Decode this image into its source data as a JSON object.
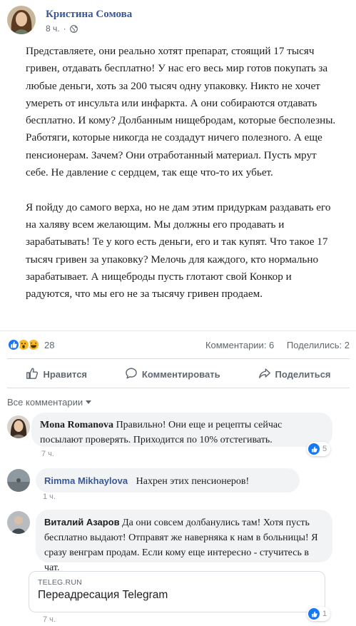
{
  "post": {
    "author": "Кристина Сомова",
    "time": "8 ч.",
    "separator": "·",
    "paragraphs": [
      "Представляете, они реально хотят препарат, стоящий 17 тысяч гривен, отдавать бесплатно! У нас его весь мир готов покупать за любые деньги, хоть за 200 тысяч одну упаковку. Никто не хочет умереть от инсульта или инфаркта. А они собираются отдавать бесплатно. И кому? Долбанным нищебродам, которые бесполезны. Работяги, которые никогда не создадут ничего полезного. А еще пенсионерам. Зачем? Они отработанный материал. Пусть мрут себе. Не давление с сердцем, так еще что-то их убьет.",
      "Я пойду до самого верха, но не дам этим придуркам раздавать его на халяву всем желающим. Мы должны его продавать и зарабатывать! Те у кого есть деньги, его и так купят. Что такое 17 тысяч гривен за упаковку? Мелочь для каждого, кто нормально зарабатывает. А нищеброды пусть глотают свой Конкор и радуются, что мы его не за тысячу гривен продаем."
    ],
    "reaction_icons": [
      "like-icon",
      "wow-icon",
      "haha-icon"
    ],
    "reaction_count": "28",
    "comments_count": "Комментарии: 6",
    "shares_count": "Поделились: 2"
  },
  "actions": {
    "like": "Нравится",
    "comment": "Комментировать",
    "share": "Поделиться"
  },
  "comments_header": "Все комментарии",
  "comments": [
    {
      "name": "Mona Romanova",
      "text": "Правильно! Они еще и рецепты сейчас посылают проверять. Приходится по 10% отстегивать.",
      "time": "7 ч.",
      "likes": "5"
    },
    {
      "name": "Rimma Mikhaylova",
      "text": "Нахрен этих пенсионеров!",
      "time": "1 ч."
    },
    {
      "name": "Виталий Азаров",
      "text": "Да они совсем долбанулись там! Хотя пусть бесплатно выдают! Отправят же наверняка к нам в больницы! Я сразу венграм продам. Если кому еще интересно - стучитесь в чат.",
      "time": "7 ч.",
      "likes": "1",
      "link": {
        "domain": "TELEG.RUN",
        "title": "Переадресация Telegram"
      }
    }
  ],
  "colors": {
    "name_blue": "#385898",
    "like_blue": "#1877f2",
    "reaction_yellow": "#f7b928",
    "bubble_gray": "#f2f3f5",
    "meta_gray": "#606770"
  }
}
